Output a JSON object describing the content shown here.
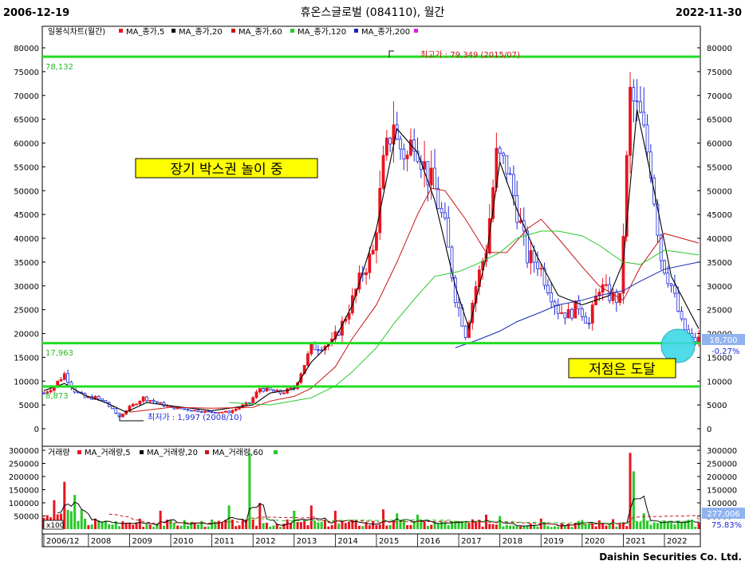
{
  "header": {
    "start_date": "2006-12-19",
    "title": "휴온스글로벌 (084110), 월간",
    "end_date": "2022-11-30",
    "footer": "Daishin Securities Co. Ltd."
  },
  "colors": {
    "up": "#e8141e",
    "down": "#1e2ad8",
    "ma5": "#000000",
    "ma20": "#c81414",
    "ma60": "#28c828",
    "ma120": "#1428b4",
    "hline": "#22dd22",
    "annot_bg": "#ffff00",
    "circle": "#3cd8e6"
  },
  "legend_price": {
    "main": "일봉식차트(월간)",
    "ma5": "MA_종가,5",
    "ma20": "MA_종가,20",
    "ma60": "MA_종가,60",
    "ma120": "MA_종가,120",
    "ma200": "MA_종가,200"
  },
  "legend_volume": {
    "main": "거래량",
    "ma5": "MA_거래량,5",
    "ma20": "MA_거래량,20",
    "ma60": "MA_거래량,60"
  },
  "annotations": {
    "high": "최고가 : 79,349 (2015/07)",
    "low": "최저가 : 1,997 (2008/10)",
    "box": "장기 박스권 놀이 중",
    "bottom": "저점은 도달",
    "line_top_label": "78,132",
    "line_mid_label": "17,963",
    "line_low_label": "8,873",
    "current_price": "18,700",
    "current_change": "-0.27%",
    "current_volume": "277,006",
    "volume_ratio": "75.83%",
    "volume_unit": "x100"
  },
  "chart_data": [
    {
      "type": "candlestick",
      "title": "휴온스글로벌 (084110), 월간",
      "x_range": [
        "2006-12",
        "2022-11"
      ],
      "ylim": [
        0,
        80000
      ],
      "y_ticks": [
        0,
        5000,
        10000,
        15000,
        20000,
        25000,
        30000,
        35000,
        40000,
        45000,
        50000,
        55000,
        60000,
        65000,
        70000,
        75000,
        80000
      ],
      "y_tick_labels": [
        "0",
        "5000",
        "10000",
        "15000",
        "20000",
        "25000",
        "30000",
        "35000",
        "40000",
        "45000",
        "50000",
        "55000",
        "60000",
        "65000",
        "70000",
        "75000",
        "80000"
      ],
      "x_ticks": [
        "2006/12",
        "2008",
        "2009",
        "2010",
        "2011",
        "2012",
        "2013",
        "2014",
        "2015",
        "2016",
        "2017",
        "2018",
        "2019",
        "2020",
        "2021",
        "2022"
      ],
      "horizontal_lines": [
        78132,
        17963,
        8873
      ],
      "high": {
        "value": 79349,
        "date": "2015/07"
      },
      "low": {
        "value": 1997,
        "date": "2008/10"
      },
      "close_path": [
        [
          "2006-12",
          7500
        ],
        [
          "2007-03",
          9000
        ],
        [
          "2007-06",
          11500
        ],
        [
          "2007-09",
          8000
        ],
        [
          "2007-12",
          6500
        ],
        [
          "2008-03",
          6500
        ],
        [
          "2008-06",
          5500
        ],
        [
          "2008-10",
          2500
        ],
        [
          "2009-01",
          4500
        ],
        [
          "2009-05",
          6500
        ],
        [
          "2009-09",
          5500
        ],
        [
          "2010-01",
          4500
        ],
        [
          "2010-06",
          4000
        ],
        [
          "2010-12",
          3500
        ],
        [
          "2011-06",
          3500
        ],
        [
          "2011-12",
          5500
        ],
        [
          "2012-03",
          8500
        ],
        [
          "2012-09",
          7500
        ],
        [
          "2013-01",
          8500
        ],
        [
          "2013-06",
          17000
        ],
        [
          "2013-12",
          18000
        ],
        [
          "2014-03",
          22000
        ],
        [
          "2014-06",
          27000
        ],
        [
          "2014-09",
          33000
        ],
        [
          "2014-12",
          37000
        ],
        [
          "2015-03",
          55000
        ],
        [
          "2015-06",
          65000
        ],
        [
          "2015-07",
          60000
        ],
        [
          "2015-10",
          57000
        ],
        [
          "2015-12",
          62000
        ],
        [
          "2016-03",
          55000
        ],
        [
          "2016-06",
          50000
        ],
        [
          "2016-09",
          42000
        ],
        [
          "2016-12",
          28000
        ],
        [
          "2017-03",
          20000
        ],
        [
          "2017-06",
          30000
        ],
        [
          "2017-09",
          38000
        ],
        [
          "2017-12",
          57000
        ],
        [
          "2018-03",
          55000
        ],
        [
          "2018-06",
          46000
        ],
        [
          "2018-09",
          36000
        ],
        [
          "2018-12",
          35000
        ],
        [
          "2019-03",
          30000
        ],
        [
          "2019-06",
          25000
        ],
        [
          "2019-09",
          24000
        ],
        [
          "2019-12",
          26000
        ],
        [
          "2020-03",
          22000
        ],
        [
          "2020-06",
          30000
        ],
        [
          "2020-09",
          28000
        ],
        [
          "2020-12",
          27000
        ],
        [
          "2021-03",
          70000
        ],
        [
          "2021-06",
          65000
        ],
        [
          "2021-09",
          55000
        ],
        [
          "2021-12",
          36000
        ],
        [
          "2022-03",
          30000
        ],
        [
          "2022-06",
          22000
        ],
        [
          "2022-09",
          18500
        ],
        [
          "2022-11",
          18700
        ]
      ],
      "ma5": [
        [
          "2006-12",
          8000
        ],
        [
          "2007-06",
          9500
        ],
        [
          "2007-12",
          7000
        ],
        [
          "2008-06",
          5500
        ],
        [
          "2008-12",
          3500
        ],
        [
          "2009-06",
          5500
        ],
        [
          "2010-01",
          4800
        ],
        [
          "2011-01",
          3800
        ],
        [
          "2012-01",
          5000
        ],
        [
          "2012-06",
          7500
        ],
        [
          "2013-01",
          8300
        ],
        [
          "2013-06",
          14000
        ],
        [
          "2014-01",
          19000
        ],
        [
          "2014-06",
          26000
        ],
        [
          "2015-01",
          42000
        ],
        [
          "2015-07",
          63000
        ],
        [
          "2016-01",
          58000
        ],
        [
          "2016-06",
          48000
        ],
        [
          "2016-12",
          30000
        ],
        [
          "2017-04",
          21000
        ],
        [
          "2017-09",
          36000
        ],
        [
          "2018-01",
          56000
        ],
        [
          "2018-06",
          46000
        ],
        [
          "2018-12",
          36000
        ],
        [
          "2019-06",
          28000
        ],
        [
          "2020-01",
          26000
        ],
        [
          "2020-09",
          28000
        ],
        [
          "2021-01",
          35000
        ],
        [
          "2021-05",
          67000
        ],
        [
          "2021-10",
          50000
        ],
        [
          "2022-03",
          32000
        ],
        [
          "2022-11",
          21000
        ]
      ],
      "ma20": [
        [
          "2009-01",
          3500
        ],
        [
          "2010-01",
          4500
        ],
        [
          "2011-01",
          4300
        ],
        [
          "2012-01",
          4500
        ],
        [
          "2012-06",
          5800
        ],
        [
          "2013-01",
          6800
        ],
        [
          "2013-06",
          8500
        ],
        [
          "2014-01",
          13000
        ],
        [
          "2014-06",
          19000
        ],
        [
          "2015-01",
          26000
        ],
        [
          "2015-07",
          35000
        ],
        [
          "2016-01",
          45000
        ],
        [
          "2016-05",
          50500
        ],
        [
          "2016-09",
          50000
        ],
        [
          "2017-03",
          44000
        ],
        [
          "2017-09",
          37000
        ],
        [
          "2018-03",
          37000
        ],
        [
          "2018-09",
          42000
        ],
        [
          "2019-01",
          44000
        ],
        [
          "2019-06",
          40000
        ],
        [
          "2020-01",
          34000
        ],
        [
          "2020-06",
          30000
        ],
        [
          "2021-01",
          27000
        ],
        [
          "2021-06",
          34000
        ],
        [
          "2022-01",
          41000
        ],
        [
          "2022-11",
          39000
        ]
      ],
      "ma60": [
        [
          "2011-06",
          5500
        ],
        [
          "2012-06",
          5000
        ],
        [
          "2013-06",
          6500
        ],
        [
          "2014-01",
          9000
        ],
        [
          "2014-06",
          12000
        ],
        [
          "2015-01",
          17000
        ],
        [
          "2015-06",
          22000
        ],
        [
          "2016-01",
          28000
        ],
        [
          "2016-06",
          32000
        ],
        [
          "2017-01",
          33000
        ],
        [
          "2017-06",
          34500
        ],
        [
          "2018-01",
          37000
        ],
        [
          "2018-06",
          40000
        ],
        [
          "2019-01",
          41500
        ],
        [
          "2019-06",
          41500
        ],
        [
          "2020-01",
          40500
        ],
        [
          "2020-06",
          38500
        ],
        [
          "2021-01",
          35000
        ],
        [
          "2021-06",
          34500
        ],
        [
          "2022-01",
          37500
        ],
        [
          "2022-11",
          36500
        ]
      ],
      "ma120": [
        [
          "2016-12",
          17000
        ],
        [
          "2017-06",
          18500
        ],
        [
          "2018-01",
          20500
        ],
        [
          "2018-06",
          22500
        ],
        [
          "2019-01",
          24500
        ],
        [
          "2019-06",
          26000
        ],
        [
          "2020-01",
          27000
        ],
        [
          "2020-06",
          28000
        ],
        [
          "2021-01",
          29000
        ],
        [
          "2021-06",
          31000
        ],
        [
          "2022-01",
          33500
        ],
        [
          "2022-11",
          35000
        ]
      ]
    },
    {
      "type": "bar",
      "title": "거래량",
      "ylim": [
        0,
        300000
      ],
      "y_ticks": [
        50000,
        100000,
        150000,
        200000,
        250000,
        300000
      ],
      "y_tick_labels": [
        "50000",
        "100000",
        "150000",
        "200000",
        "250000",
        "300000"
      ],
      "spikes": [
        [
          "2007-03",
          110000
        ],
        [
          "2007-06",
          180000
        ],
        [
          "2007-09",
          130000
        ],
        [
          "2008-03",
          40000
        ],
        [
          "2009-04",
          40000
        ],
        [
          "2009-10",
          70000
        ],
        [
          "2011-06",
          90000
        ],
        [
          "2011-12",
          290000
        ],
        [
          "2012-03",
          100000
        ],
        [
          "2013-01",
          70000
        ],
        [
          "2013-06",
          90000
        ],
        [
          "2014-01",
          70000
        ],
        [
          "2015-03",
          75000
        ],
        [
          "2015-07",
          60000
        ],
        [
          "2016-01",
          55000
        ],
        [
          "2017-09",
          55000
        ],
        [
          "2018-01",
          50000
        ],
        [
          "2019-01",
          40000
        ],
        [
          "2021-03",
          290000
        ],
        [
          "2021-04",
          220000
        ],
        [
          "2021-07",
          60000
        ],
        [
          "2022-03",
          25000
        ]
      ]
    }
  ]
}
